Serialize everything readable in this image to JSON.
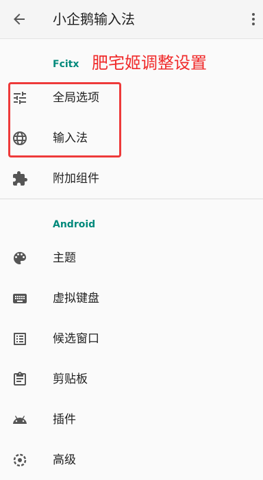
{
  "appbar": {
    "title": "小企鹅输入法",
    "back_icon": "arrow-back-icon",
    "more_icon": "more-vert-icon"
  },
  "annotation": "肥宅姬调整设置",
  "sections": {
    "fcitx": {
      "header": "Fcitx",
      "items": [
        {
          "label": "全局选项",
          "icon": "tune-icon"
        },
        {
          "label": "输入法",
          "icon": "globe-icon"
        },
        {
          "label": "附加组件",
          "icon": "extension-icon"
        }
      ]
    },
    "android": {
      "header": "Android",
      "items": [
        {
          "label": "主题",
          "icon": "palette-icon"
        },
        {
          "label": "虚拟键盘",
          "icon": "keyboard-icon"
        },
        {
          "label": "候选窗口",
          "icon": "list-alt-icon"
        },
        {
          "label": "剪贴板",
          "icon": "clipboard-icon"
        },
        {
          "label": "插件",
          "icon": "android-icon"
        },
        {
          "label": "高级",
          "icon": "advanced-icon"
        }
      ]
    }
  },
  "colors": {
    "accent": "#00897b",
    "annotation": "#f02a2a",
    "icon": "#555555"
  }
}
